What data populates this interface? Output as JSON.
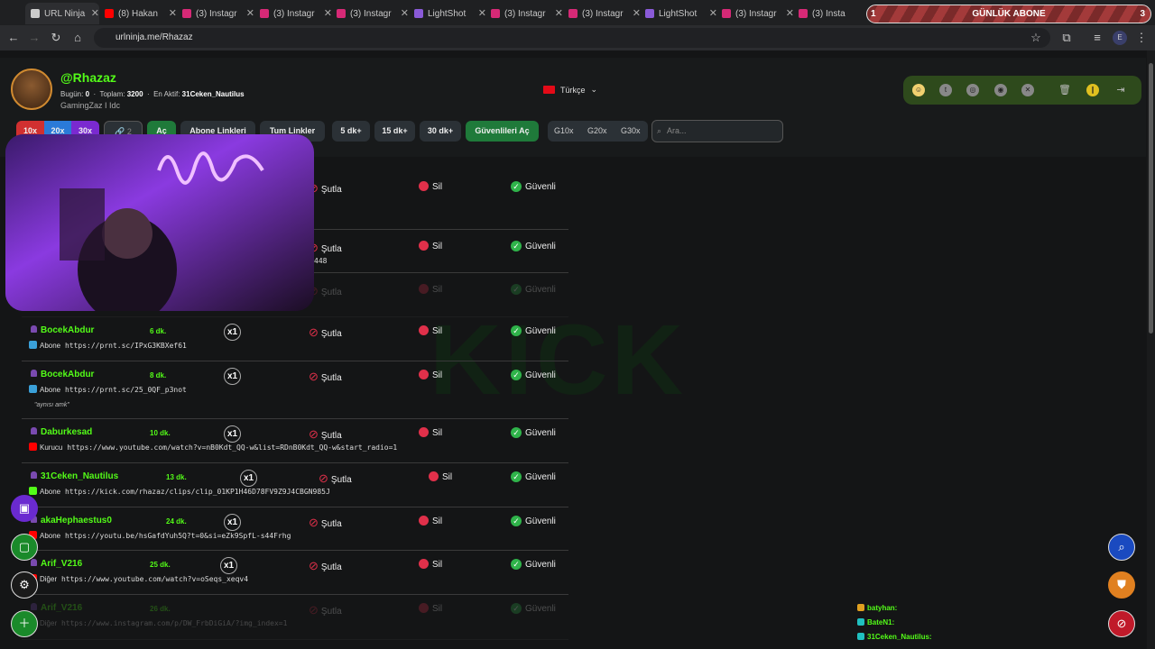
{
  "browser": {
    "tabs": [
      {
        "label": "URL Ninja",
        "color": "#cccccc"
      },
      {
        "label": "(8) Hakan",
        "color": "#ff0000"
      },
      {
        "label": "(3) Instagr",
        "color": "#d62976"
      },
      {
        "label": "(3) Instagr",
        "color": "#d62976"
      },
      {
        "label": "(3) Instagr",
        "color": "#d62976"
      },
      {
        "label": "LightShot",
        "color": "#8a5ad8"
      },
      {
        "label": "(3) Instagr",
        "color": "#d62976"
      },
      {
        "label": "(3) Instagr",
        "color": "#d62976"
      },
      {
        "label": "LightShot",
        "color": "#8a5ad8"
      },
      {
        "label": "(3) Instagr",
        "color": "#d62976"
      },
      {
        "label": "(3) Insta",
        "color": "#d62976"
      }
    ],
    "url": "urlninja.me/Rhazaz",
    "banner": {
      "label": "GÜNLÜK ABONE",
      "current": "1",
      "target": "3"
    }
  },
  "profile": {
    "username": "@Rhazaz",
    "today_label": "Bugün:",
    "today_value": "0",
    "total_label": "Toplam:",
    "total_value": "3200",
    "most_active_label": "En Aktif:",
    "most_active_value": "31Ceken_Nautilus",
    "bio": "GamingZaz I Idc",
    "language": "Türkçe"
  },
  "toolbar": {
    "mult": [
      "10x",
      "20x",
      "30x"
    ],
    "link_count": "2",
    "ac": "Aç",
    "abone_linkleri": "Abone Linkleri",
    "tum_linkler": "Tum Linkler",
    "dk5": "5 dk+",
    "dk15": "15 dk+",
    "dk30": "30 dk+",
    "guvenlileri_ac": "Güvenlileri Aç",
    "g": [
      "G10x",
      "G20x",
      "G30x"
    ],
    "search_placeholder": "Ara..."
  },
  "actions": {
    "sutla": "Şutla",
    "sil": "Sil",
    "guvenli": "Güvenli"
  },
  "rows": [
    {
      "user": "",
      "time": "",
      "x": "",
      "type": "",
      "url": "",
      "note": "",
      "faded": false
    },
    {
      "user": "",
      "time": "",
      "x": "",
      "type": "",
      "url": "448",
      "note": "",
      "faded": false
    },
    {
      "user": "",
      "time": "",
      "x": "",
      "type": "",
      "url": "",
      "note": "",
      "faded": true
    },
    {
      "user": "BocekAbdur",
      "time": "6 dk.",
      "x": "x1",
      "type": "Abone",
      "url": "https://prnt.sc/IPxG3KBXef61",
      "note": "",
      "icon": "#3aa0d8",
      "faded": false
    },
    {
      "user": "BocekAbdur",
      "time": "8 dk.",
      "x": "x1",
      "type": "Abone",
      "url": "https://prnt.sc/25_0QF_p3not",
      "note": "\"aynısı amk\"",
      "icon": "#3aa0d8",
      "faded": false
    },
    {
      "user": "Daburkesad",
      "time": "10 dk.",
      "x": "x1",
      "type": "Kurucu",
      "url": "https://www.youtube.com/watch?v=nB0Kdt_QQ-w&list=RDnB0Kdt_QQ-w&start_radio=1",
      "note": "",
      "icon": "#ff0000",
      "faded": false
    },
    {
      "user": "31Ceken_Nautilus",
      "time": "13 dk.",
      "x": "x1",
      "type": "Abone",
      "url": "https://kick.com/rhazaz/clips/clip_01KP1H46D78FV9Z9J4CBGN985J",
      "note": "",
      "icon": "#53fc18",
      "faded": false
    },
    {
      "user": "akaHephaestus0",
      "time": "24 dk.",
      "x": "x1",
      "type": "Abone",
      "url": "https://youtu.be/hsGafdYuh5Q?t=0&si=eZk9SpfL-s44Frhg",
      "note": "",
      "icon": "#ff0000",
      "faded": false
    },
    {
      "user": "Arif_V216",
      "time": "25 dk.",
      "x": "x1",
      "type": "Diğer",
      "url": "https://www.youtube.com/watch?v=oSeqs_xeqv4",
      "note": "",
      "icon": "#ff0000",
      "faded": false
    },
    {
      "user": "Arif_V216",
      "time": "26 dk.",
      "x": "",
      "type": "Diğer",
      "url": "https://www.instagram.com/p/DW_FrbDiGiA/?img_index=1",
      "note": "",
      "icon": "#d62976",
      "faded": true
    }
  ],
  "chat": [
    {
      "name": "batyhan:",
      "badge": "#e0a020"
    },
    {
      "name": "BateN1:",
      "badge": "#20c0c0"
    },
    {
      "name": "31Ceken_Nautilus:",
      "badge": "#20c0c0"
    }
  ],
  "icons": {
    "twitch": "twitch-icon",
    "kick": "kick-icon",
    "settings": "gear-icon",
    "add_user": "add-user-icon",
    "search": "search-icon",
    "shield": "shield-icon",
    "block": "block-user-icon"
  },
  "colors": {
    "accent": "#53fc18",
    "danger": "#e0304a",
    "safe": "#2fb34a"
  }
}
